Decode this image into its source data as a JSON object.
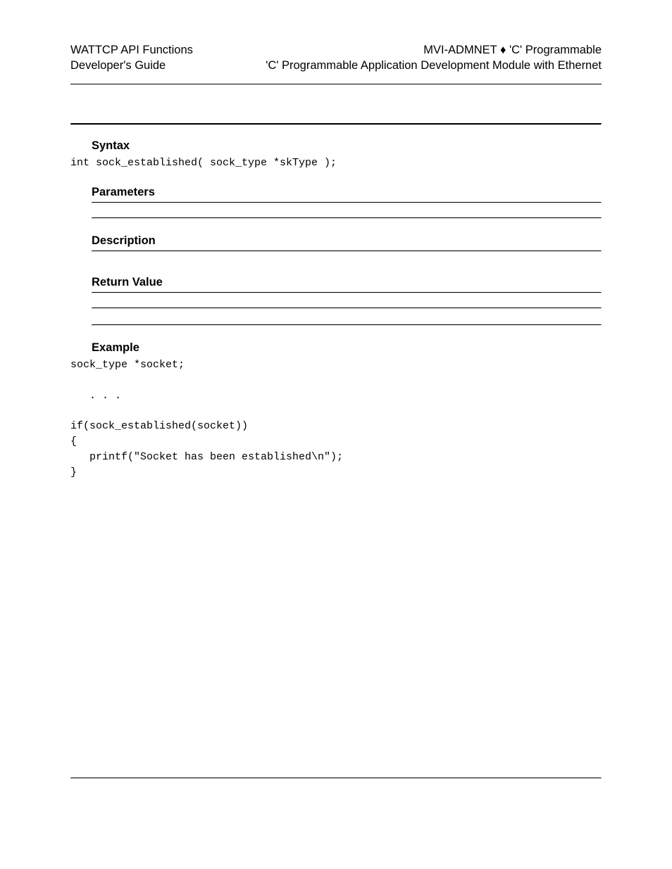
{
  "header": {
    "left_line1": "WATTCP API Functions",
    "left_line2": "Developer's Guide",
    "right_line1": "MVI-ADMNET ♦ 'C' Programmable",
    "right_line2": "'C' Programmable Application Development Module with Ethernet"
  },
  "sections": {
    "syntax": {
      "heading": "Syntax",
      "code": "int sock_established( sock_type *skType );"
    },
    "parameters": {
      "heading": "Parameters"
    },
    "description": {
      "heading": "Description"
    },
    "return_value": {
      "heading": "Return Value"
    },
    "example": {
      "heading": "Example",
      "code": "sock_type *socket;\n\n   . . .\n\nif(sock_established(socket))\n{\n   printf(\"Socket has been established\\n\");\n}"
    }
  }
}
